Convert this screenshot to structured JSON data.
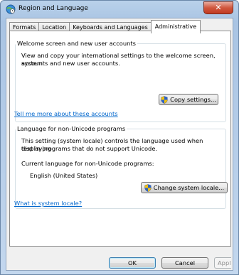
{
  "window": {
    "title": "Region and Language",
    "close_label": "✕"
  },
  "tabs": [
    {
      "label": "Formats",
      "active": false
    },
    {
      "label": "Location",
      "active": false
    },
    {
      "label": "Keyboards and Languages",
      "active": false
    },
    {
      "label": "Administrative",
      "active": true
    }
  ],
  "welcome": {
    "title": "Welcome screen and new user accounts",
    "description_line1": "View and copy your international settings to the welcome screen, system",
    "description_line2": "accounts and new user accounts.",
    "copy_button": "Copy settings...",
    "link": "Tell me more about these accounts"
  },
  "unicode": {
    "title": "Language for non-Unicode programs",
    "description_line1": "This setting (system locale) controls the language used when displaying",
    "description_line2": "text in programs that do not support Unicode.",
    "current_label": "Current language for non-Unicode programs:",
    "current_value": "English (United States)",
    "change_button": "Change system locale...",
    "link": "What is system locale?"
  },
  "footer": {
    "ok": "OK",
    "cancel": "Cancel",
    "apply": "Apply"
  },
  "colors": {
    "link": "#0066cc",
    "shield_blue": "#2a62c9",
    "shield_yellow": "#f4c20d"
  }
}
